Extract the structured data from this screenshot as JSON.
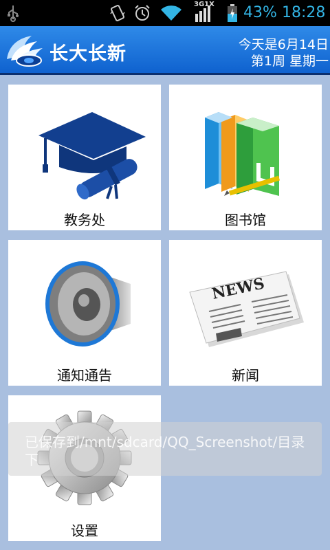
{
  "status_bar": {
    "network": "3G1X",
    "battery": "43%",
    "time": "18:28",
    "icons": [
      "usb-icon",
      "vibrate-icon",
      "alarm-icon",
      "wifi-icon",
      "signal-icon",
      "battery-icon"
    ]
  },
  "header": {
    "title": "长大长新",
    "date": "今天是6月14日",
    "week": "第1周 星期一"
  },
  "tiles": [
    {
      "label": "教务处",
      "icon": "graduation-cap-icon"
    },
    {
      "label": "图书馆",
      "icon": "books-icon"
    },
    {
      "label": "通知通告",
      "icon": "speaker-icon"
    },
    {
      "label": "新闻",
      "icon": "newspaper-icon"
    },
    {
      "label": "设置",
      "icon": "gear-icon"
    }
  ],
  "newspaper_headline": "NEWS",
  "toast": {
    "message": "已保存到/mnt/sdcard/QQ_Screenshot/目录下"
  },
  "colors": {
    "background": "#a9bfdf",
    "header": "#1a6fd8",
    "status_accent": "#33b5e5"
  }
}
